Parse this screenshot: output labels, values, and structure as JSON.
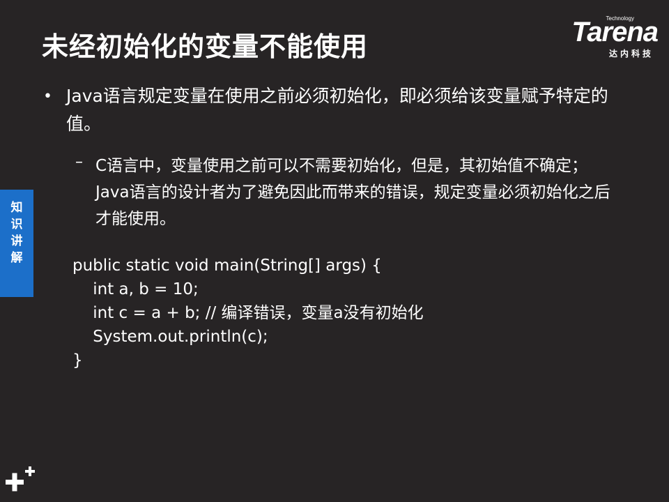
{
  "slide": {
    "title": "未经初始化的变量不能使用"
  },
  "logo": {
    "small": "Technology",
    "main": "Tarena",
    "cn": "达内科技"
  },
  "side_tab": {
    "label": "知\n识\n讲\n解",
    "color": "#1c6fc9"
  },
  "bullets": [
    {
      "marker": "•",
      "text": "Java语言规定变量在使用之前必须初始化，即必须给该变量赋予特定的值。"
    }
  ],
  "sub_bullets": [
    {
      "marker": "–",
      "text": "C语言中，变量使用之前可以不需要初始化，但是，其初始值不确定；Java语言的设计者为了避免因此而带来的错误，规定变量必须初始化之后才能使用。"
    }
  ],
  "code": [
    "public static void main(String[] args) {",
    "    int a, b = 10;",
    "    int c = a + b; // 编译错误，变量a没有初始化",
    "    System.out.println(c);",
    "}"
  ],
  "colors": {
    "background": "#272425",
    "text": "#ffffff",
    "accent": "#1c6fc9"
  }
}
